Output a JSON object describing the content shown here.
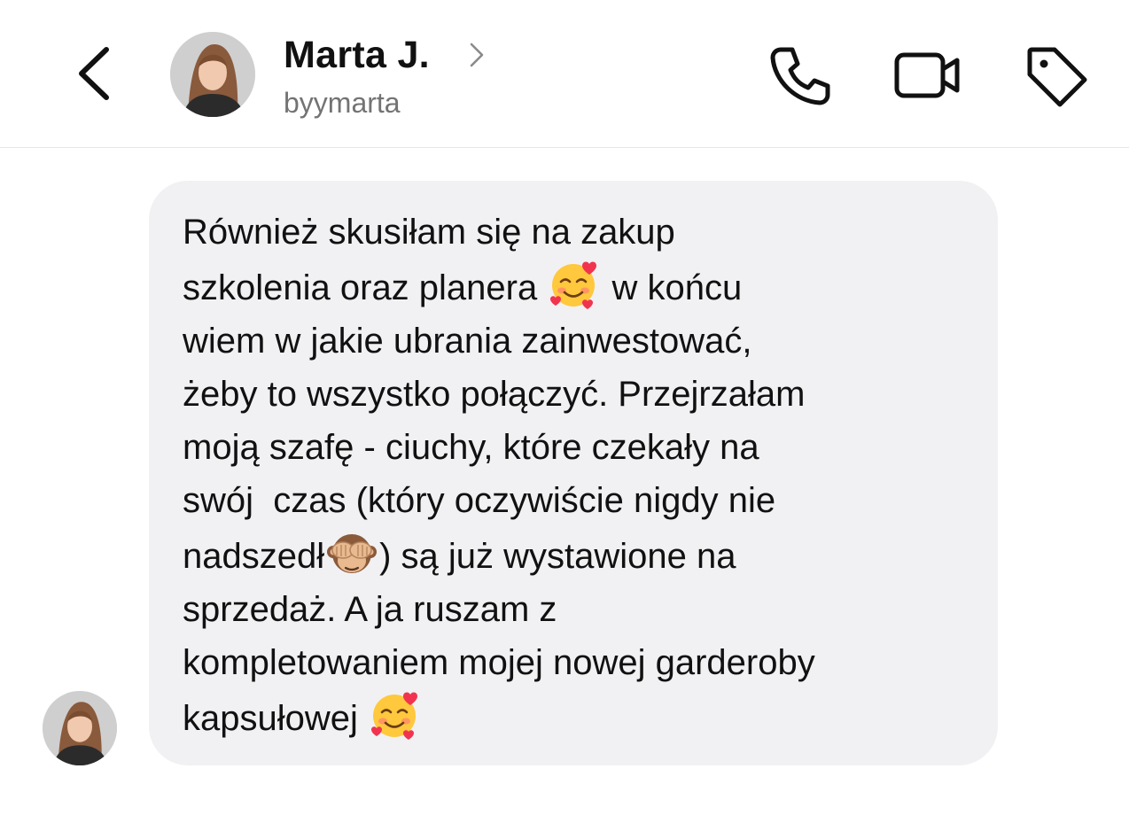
{
  "header": {
    "contact_name": "Marta J.",
    "username": "byymarta",
    "icons": {
      "back": "chevron-left-icon",
      "name_chevron": "chevron-right-icon",
      "call": "phone-icon",
      "video": "video-camera-icon",
      "tag": "tag-icon"
    }
  },
  "message": {
    "lines": [
      "Również skusiłam się na zakup",
      "szkolenia oraz planera",
      "w końcu",
      "wiem w jakie ubrania zainwestować,",
      "żeby to wszystko połączyć. Przejrzałam",
      "moją szafę - ciuchy, które czekały na",
      "swój  czas (który oczywiście nigdy nie",
      "nadszedł",
      ") są już wystawione na",
      "sprzedaż. A ja ruszam z",
      "kompletowaniem mojej nowej garderoby",
      "kapsułowej"
    ],
    "emojis": {
      "smiling_hearts": "smiling-face-with-hearts-emoji",
      "see_no_evil": "see-no-evil-monkey-emoji"
    }
  },
  "colors": {
    "bubble_background": "#f1f1f3",
    "text": "#111111",
    "username": "#737373",
    "divider": "#e6e6e6"
  }
}
